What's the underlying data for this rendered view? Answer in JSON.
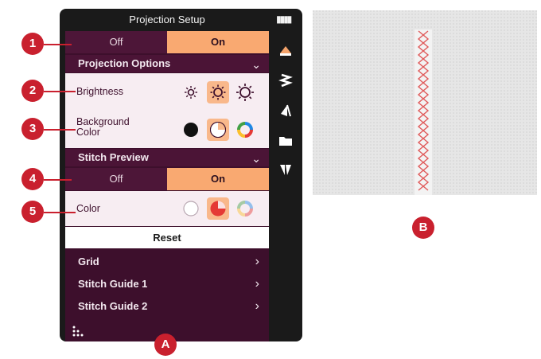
{
  "header": {
    "title": "Projection Setup",
    "battery_glyph": "▮▮▮▮"
  },
  "projection": {
    "off_label": "Off",
    "on_label": "On",
    "selected": "On"
  },
  "projection_options": {
    "title": "Projection Options",
    "chevron": "⌄"
  },
  "brightness": {
    "label": "Brightness",
    "options": [
      "low-brightness-icon",
      "medium-brightness-icon",
      "high-brightness-icon"
    ],
    "selected_index": 1
  },
  "background_color": {
    "label_line1": "Background",
    "label_line2": "Color",
    "options": [
      "black-swatch-icon",
      "white-swatch-icon",
      "multicolor-swatch-icon"
    ],
    "selected_index": 1
  },
  "stitch_preview": {
    "title": "Stitch Preview",
    "off_label": "Off",
    "on_label": "On",
    "selected": "On",
    "chevron": "⌄"
  },
  "preview_color": {
    "label": "Color",
    "options": [
      "white-circle-icon",
      "red-swatch-icon",
      "multicolor-pale-icon"
    ],
    "selected_index": 1
  },
  "reset_label": "Reset",
  "menu": {
    "items": [
      {
        "label": "Grid",
        "arrow": "›"
      },
      {
        "label": "Stitch Guide 1",
        "arrow": "›"
      },
      {
        "label": "Stitch Guide 2",
        "arrow": "›"
      }
    ]
  },
  "sidebar": {
    "icons": [
      "sewing-foot-icon",
      "zigzag-stitch-icon",
      "triangle-stitch-icon",
      "folder-icon",
      "stitch-tools-icon"
    ]
  },
  "callouts": {
    "labels": [
      "1",
      "2",
      "3",
      "4",
      "5",
      "A",
      "B"
    ]
  },
  "colors": {
    "accent": "#f9a971",
    "panel_bg": "#3d0f2c",
    "callout": "#c9202e",
    "stitch": "#e05a5a"
  }
}
